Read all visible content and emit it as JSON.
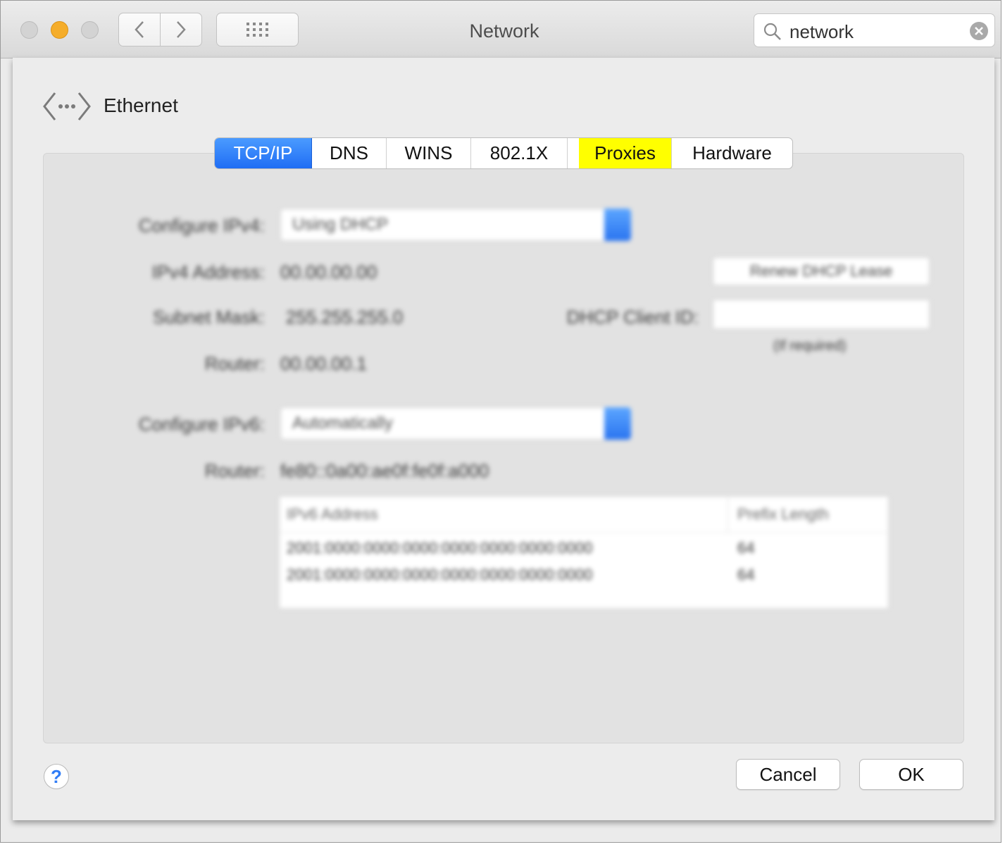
{
  "window": {
    "title": "Network"
  },
  "toolbar": {
    "back_icon": "chevron-left-icon",
    "forward_icon": "chevron-right-icon",
    "show_all_icon": "grid-icon"
  },
  "search": {
    "value": "network",
    "icon": "search-icon",
    "clear_icon": "clear-icon"
  },
  "header": {
    "title": "Ethernet",
    "icon": "ethernet-icon"
  },
  "tabs": [
    {
      "label": "TCP/IP",
      "active": true
    },
    {
      "label": "DNS"
    },
    {
      "label": "WINS"
    },
    {
      "label": "802.1X"
    },
    {
      "label": "Proxies",
      "highlighted": true
    },
    {
      "label": "Hardware"
    }
  ],
  "tcpip": {
    "configure_ipv4_label": "Configure IPv4:",
    "configure_ipv4_value": "Using DHCP",
    "ipv4_address_label": "IPv4 Address:",
    "ipv4_address_value": "00.00.00.00",
    "subnet_mask_label": "Subnet Mask:",
    "subnet_mask_value": "255.255.255.0",
    "router_label": "Router:",
    "router_value": "00.00.00.1",
    "renew_button": "Renew DHCP Lease",
    "dhcp_client_id_label": "DHCP Client ID:",
    "dhcp_client_id_value": "",
    "dhcp_client_id_hint": "(If required)",
    "configure_ipv6_label": "Configure IPv6:",
    "configure_ipv6_value": "Automatically",
    "router6_label": "Router:",
    "router6_value": "fe80::0a00:ae0f:fe0f:a000",
    "ipv6_table": {
      "columns": [
        "IPv6 Address",
        "Prefix Length"
      ],
      "rows": [
        [
          "2001:0000:0000:0000:0000:0000:0000:0000",
          "64"
        ],
        [
          "2001:0000:0000:0000:0000:0000:0000:0000",
          "64"
        ]
      ]
    }
  },
  "footer": {
    "help": "?",
    "cancel": "Cancel",
    "ok": "OK"
  }
}
